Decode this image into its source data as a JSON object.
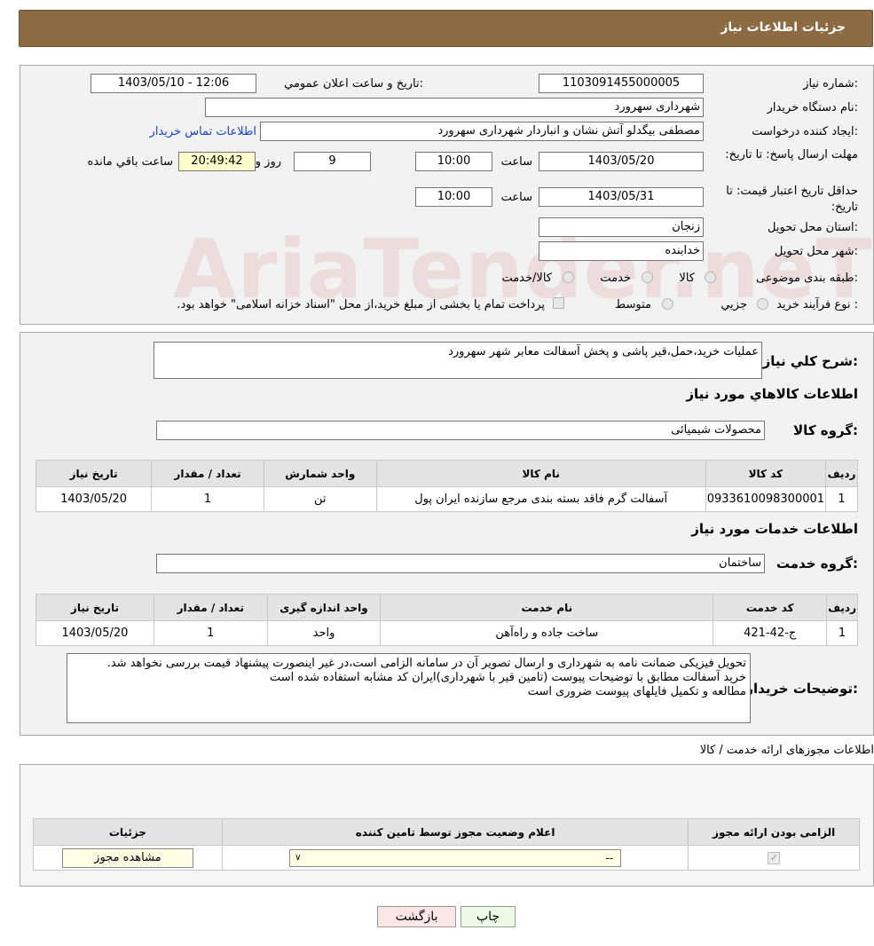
{
  "header": {
    "title": "جزئيات اطلاعات نياز"
  },
  "form": {
    "need_number_label": "شماره نياز:",
    "need_number": "1103091455000005",
    "announce_label": "تاريخ و ساعت اعلان عمومي:",
    "announce_value": "1403/05/10 - 12:06",
    "buyer_org_label": "نام دستگاه خريدار:",
    "buyer_org": "شهرداری سهرورد",
    "requester_label": "ايجاد کننده درخواست:",
    "requester": "مصطفی بیگدلو آتش نشان و انباردار شهرداری سهرورد",
    "contact_link": "اطلاعات تماس خريدار",
    "deadline_label": "مهلت ارسال پاسخ: تا تاريخ:",
    "deadline_date": "1403/05/20",
    "time_label": "ساعت",
    "deadline_time": "10:00",
    "days": "9",
    "days_label": "روز و",
    "remaining": "20:49:42",
    "remaining_label": "ساعت باقي مانده",
    "validity_label": "حداقل تاريخ اعتبار قيمت: تا تاريخ:",
    "validity_date": "1403/05/31",
    "validity_time": "10:00",
    "province_label": "استان محل تحويل:",
    "province": "زنجان",
    "city_label": "شهر محل تحويل:",
    "city": "خدابنده",
    "category_label": "طبقه بندی موضوعی:",
    "category_options": [
      "کالا",
      "خدمت",
      "کالا/خدمت"
    ],
    "process_label": "نوع فرآيند خريد :",
    "process_options": [
      "جزيي",
      "متوسط"
    ],
    "process_note": "پرداخت تمام يا بخشی از مبلغ خريد،از محل \"اسناد خزانه اسلامی\" خواهد بود."
  },
  "watermark": "AriaTender.neT",
  "description": {
    "label": "شرح کلي نياز:",
    "text": "عملیات خرید،حمل،قیر پاشی و پخش آسفالت معابر شهر سهرورد"
  },
  "goods": {
    "section_title": "اطلاعات کالاهاي مورد نياز",
    "group_label": "گروه کالا:",
    "group_value": "محصولات شیمیائی",
    "columns": [
      "رديف",
      "کد کالا",
      "نام کالا",
      "واحد شمارش",
      "تعداد / مقدار",
      "تاريخ نياز"
    ],
    "rows": [
      [
        "1",
        "0933610098300001",
        "آسفالت گرم فاقد بسته بندی مرجع سازنده ایران پول",
        "تن",
        "1",
        "1403/05/20"
      ]
    ]
  },
  "services": {
    "section_title": "اطلاعات خدمات مورد نياز",
    "group_label": "گروه خدمت:",
    "group_value": "ساختمان",
    "columns": [
      "رديف",
      "کد خدمت",
      "نام خدمت",
      "واحد اندازه گيری",
      "تعداد / مقدار",
      "تاريخ نياز"
    ],
    "rows": [
      [
        "1",
        "ج-42-421",
        "ساخت جاده و راه‌آهن",
        "واحد",
        "1",
        "1403/05/20"
      ]
    ]
  },
  "buyer_notes": {
    "label": "توضيحات خريدار:",
    "lines": [
      "تحویل فیزیکی ضمانت نامه به شهرداری و ارسال تصویر آن در سامانه الزامی است،در غیر اینصورت پیشنهاد قیمت بررسی نخواهد شد.",
      "خرید آسفالت مطابق با توضیحات پیوست (تامین قیر با شهرداری)ایران کد مشابه استفاده شده است",
      "مطالعه و تکمیل فایلهای پیوست ضروری است"
    ]
  },
  "permits": {
    "title": "اطلاعات مجوزهای ارائه خدمت / کالا",
    "columns": [
      "الزامی بودن ارائه مجوز",
      "اعلام وضعيت مجوز توسط تامين کننده",
      "جزئيات"
    ],
    "select_value": "--",
    "view_button": "مشاهده مجوز"
  },
  "actions": {
    "print": "چاپ",
    "back": "بازگشت"
  }
}
